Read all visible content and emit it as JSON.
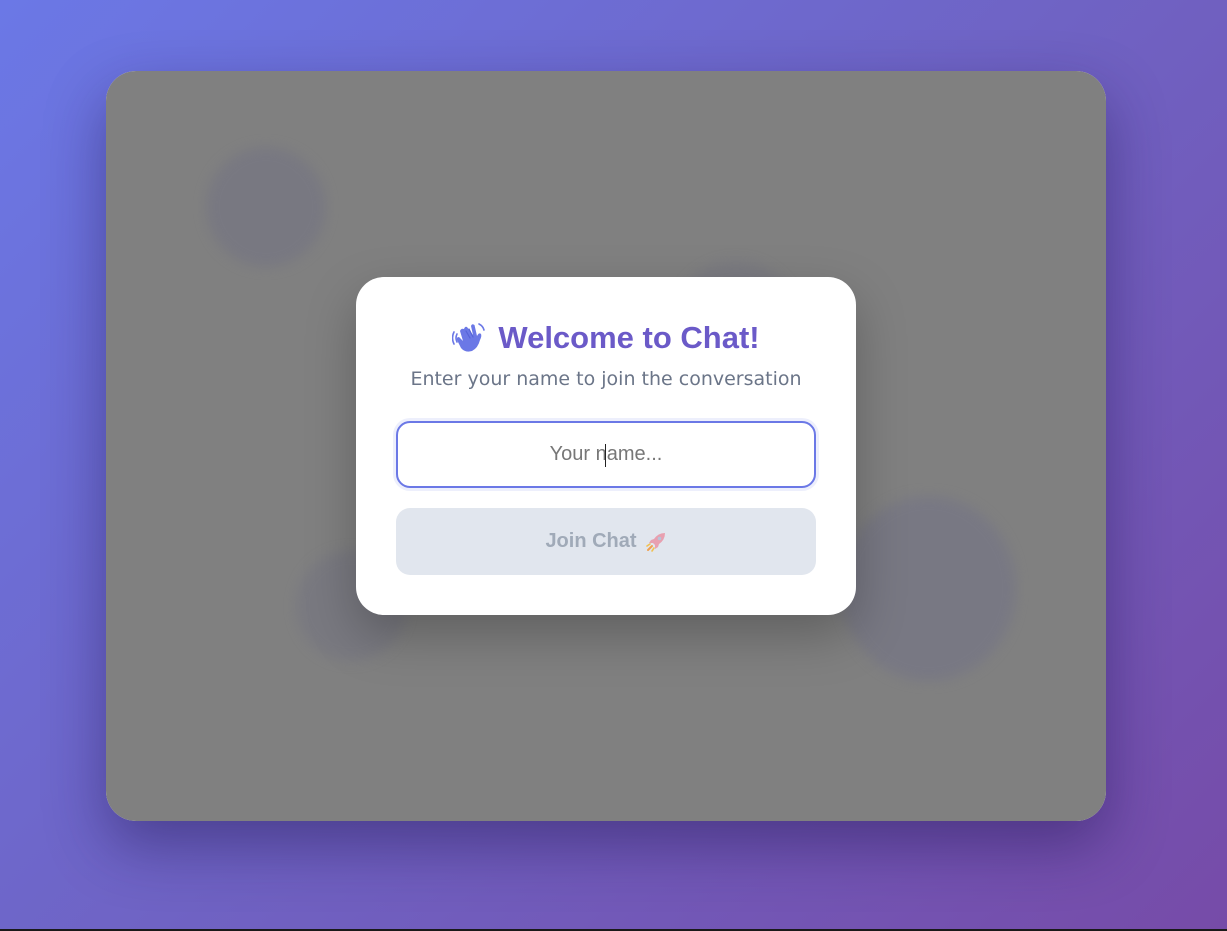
{
  "modal": {
    "title_icon": "waving-hand-icon",
    "title": "Welcome to Chat!",
    "subtitle": "Enter your name to join the conversation",
    "name_input": {
      "value": "",
      "placeholder": "Your name..."
    },
    "join_button": {
      "label": "Join Chat",
      "icon": "rocket-icon",
      "disabled": true
    }
  },
  "colors": {
    "accent": "#6b78e6",
    "title": "#6b5ac8",
    "subtitle": "#6b7588",
    "button_disabled_bg": "#e1e6ee",
    "button_disabled_text": "#a0aab8",
    "overlay": "#808080"
  }
}
